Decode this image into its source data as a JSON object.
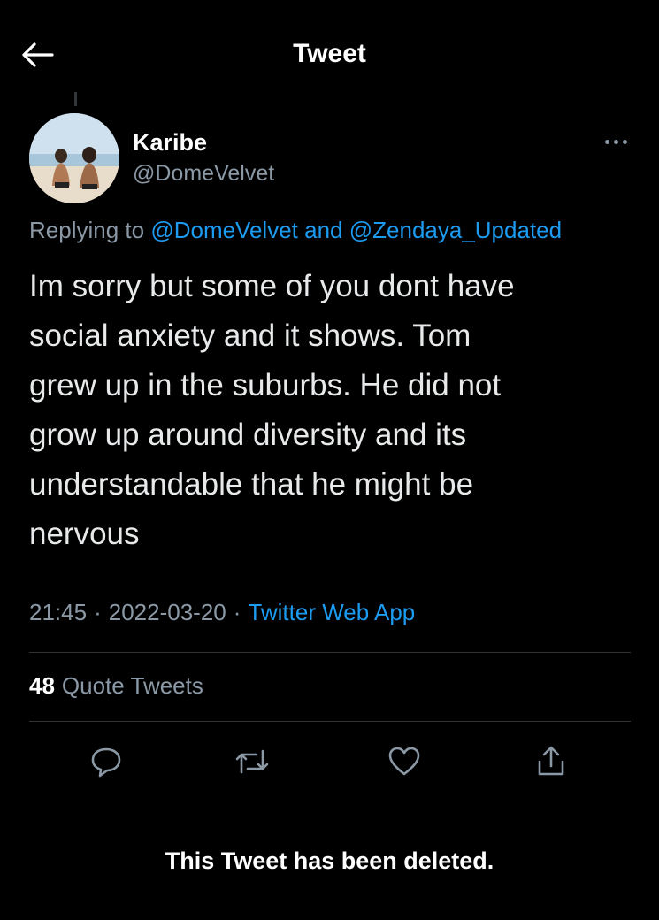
{
  "header": {
    "title": "Tweet",
    "back_icon": "arrow-left-icon"
  },
  "author": {
    "name": "Karibe",
    "handle": "@DomeVelvet"
  },
  "reply": {
    "prefix": "Replying to",
    "mention1": "@DomeVelvet",
    "conjunction": "and",
    "mention2": "@Zendaya_Updated"
  },
  "tweet": {
    "lines": [
      "Im sorry but some of you dont have",
      "social anxiety and it shows. Tom",
      "grew up in the suburbs. He did not",
      "grow up around diversity and its",
      "understandable that he might be",
      "nervous"
    ]
  },
  "meta": {
    "time": "21:45",
    "separator": "·",
    "date": "2022-03-20",
    "source": "Twitter Web App"
  },
  "stats": {
    "quote_count": "48",
    "quote_label": "Quote Tweets"
  },
  "actions": {
    "reply_icon": "reply-icon",
    "retweet_icon": "retweet-icon",
    "like_icon": "heart-icon",
    "share_icon": "share-icon"
  },
  "notice": "This Tweet has been deleted.",
  "colors": {
    "background": "#000000",
    "link": "#1d9bf0",
    "secondary_text": "#8b98a5",
    "divider": "#2f3336"
  }
}
